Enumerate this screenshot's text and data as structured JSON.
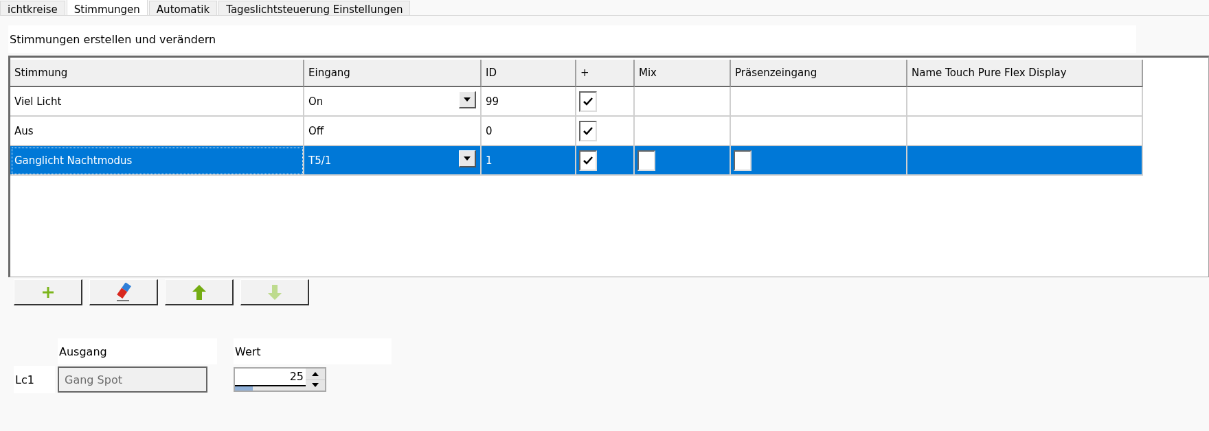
{
  "tabs": [
    {
      "label": "ichtkreise",
      "selected": false
    },
    {
      "label": "Stimmungen",
      "selected": true
    },
    {
      "label": "Automatik",
      "selected": false
    },
    {
      "label": "Tageslichtsteuerung Einstellungen",
      "selected": false
    }
  ],
  "section_title": "Stimmungen erstellen und verändern",
  "table": {
    "columns": [
      "Stimmung",
      "Eingang",
      "ID",
      "+",
      "Mix",
      "Präsenzeingang",
      "Name Touch Pure Flex Display"
    ],
    "rows": [
      {
        "stimmung": "Viel Licht",
        "eingang": "On",
        "eingang_dropdown": true,
        "id": "99",
        "plus": {
          "checked": true
        },
        "selected": false
      },
      {
        "stimmung": "Aus",
        "eingang": "Off",
        "eingang_dropdown": false,
        "id": "0",
        "plus": {
          "checked": true
        },
        "selected": false
      },
      {
        "stimmung": "Ganglicht Nachtmodus",
        "eingang": "T5/1",
        "eingang_dropdown": true,
        "id": "1",
        "plus": {
          "checked": true
        },
        "mix": {
          "checked": false
        },
        "praesenz": {
          "checked": false
        },
        "selected": true
      }
    ]
  },
  "toolbar": [
    {
      "kind": "add",
      "disabled": false
    },
    {
      "kind": "erase",
      "disabled": false
    },
    {
      "kind": "up",
      "disabled": false
    },
    {
      "kind": "down",
      "disabled": true
    }
  ],
  "outputs": {
    "headers": [
      "Ausgang",
      "Wert"
    ],
    "rows": [
      {
        "label": "Lc1",
        "ausgang": "Gang Spot",
        "wert": "25",
        "level": 0.25
      }
    ]
  }
}
